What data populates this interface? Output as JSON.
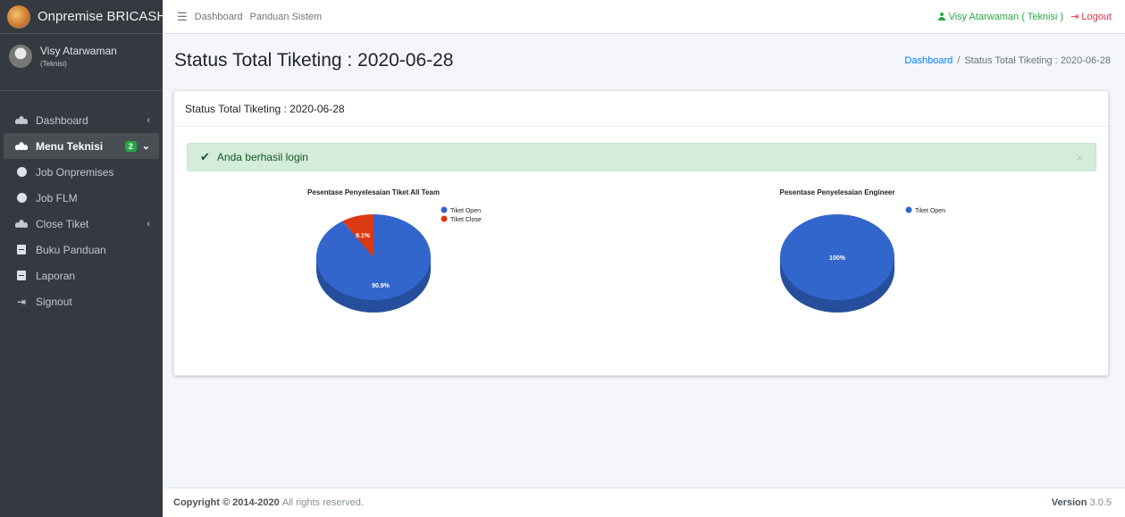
{
  "brand": {
    "name": "Onpremise BRICASH"
  },
  "user": {
    "name": "Visy Atarwaman",
    "role": "(Teknisi)"
  },
  "sidebar": {
    "items": [
      {
        "label": "Dashboard",
        "icon": "users-icon",
        "chevron": "‹"
      },
      {
        "label": "Menu Teknisi",
        "icon": "users-icon",
        "badge": "2",
        "chevron": "⌄"
      },
      {
        "label": "Job Onpremises",
        "icon": "circle-icon"
      },
      {
        "label": "Job FLM",
        "icon": "circle-icon"
      },
      {
        "label": "Close Tiket",
        "icon": "users-icon",
        "chevron": "‹"
      },
      {
        "label": "Buku Panduan",
        "icon": "book-icon"
      },
      {
        "label": "Laporan",
        "icon": "book-icon"
      },
      {
        "label": "Signout",
        "icon": "sign-out-icon"
      }
    ]
  },
  "topbar": {
    "links": [
      "Dashboard",
      "Panduan Sistem"
    ],
    "user_link": "Visy Atarwaman ( Teknisi )",
    "logout": "Logout"
  },
  "header": {
    "title": "Status Total Tiketing : 2020-06-28",
    "breadcrumb_home": "Dashboard",
    "breadcrumb_current": "Status Total Tiketing : 2020-06-28"
  },
  "card": {
    "title": "Status Total Tiketing : 2020-06-28",
    "alert": "Anda berhasil login"
  },
  "colors": {
    "open": "#3366cc",
    "close": "#dc3912",
    "open_side": "#254f9c",
    "close_side": "#a22a0e"
  },
  "chart_data": [
    {
      "type": "pie",
      "title": "Pesentase Penyelesaian Tiket All Team",
      "series": [
        {
          "name": "Tiket Open",
          "value": 90.9,
          "label": "90.9%"
        },
        {
          "name": "Tiket Close",
          "value": 9.1,
          "label": "9.1%"
        }
      ],
      "legend": "right"
    },
    {
      "type": "pie",
      "title": "Pesentase Penyelesaian Engineer",
      "series": [
        {
          "name": "Tiket Open",
          "value": 100,
          "label": "100%"
        }
      ],
      "legend": "right"
    }
  ],
  "footer": {
    "copyright": "Copyright © 2014-2020",
    "rights": "All rights reserved.",
    "version_label": "Version",
    "version": "3.0.5"
  }
}
